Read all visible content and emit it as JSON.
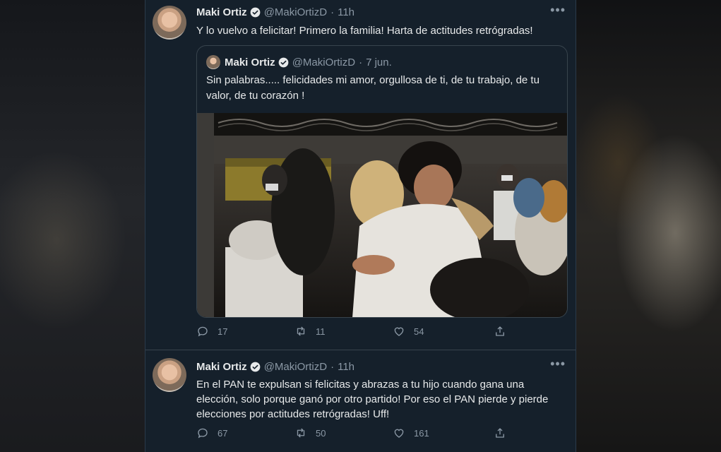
{
  "tweets": [
    {
      "name": "Maki Ortiz",
      "handle": "@MakiOrtizD",
      "time": "11h",
      "text": "Y lo vuelvo a felicitar! Primero la familia! Harta de actitudes retrógradas!",
      "quote": {
        "name": "Maki Ortiz",
        "handle": "@MakiOrtizD",
        "time": "7 jun.",
        "text": "Sin palabras..... felicidades mi amor, orgullosa de ti, de tu trabajo, de tu valor, de tu corazón !"
      },
      "replies": "17",
      "retweets": "11",
      "likes": "54"
    },
    {
      "name": "Maki Ortiz",
      "handle": "@MakiOrtizD",
      "time": "11h",
      "text": "En el PAN te expulsan si felicitas  y abrazas a tu hijo cuando gana una elección,  solo porque ganó por otro partido! Por eso el PAN pierde y pierde elecciones por actitudes retrógradas! Uff!",
      "replies": "67",
      "retweets": "50",
      "likes": "161"
    }
  ],
  "ui": {
    "dot": "·",
    "more": "•••"
  },
  "colors": {
    "background": "#15202b",
    "border": "#38444d",
    "muted": "#8b98a5",
    "verified": "#1d9bf0"
  },
  "icons": [
    "verified-badge-icon",
    "reply-icon",
    "retweet-icon",
    "like-icon",
    "share-icon",
    "more-icon"
  ]
}
